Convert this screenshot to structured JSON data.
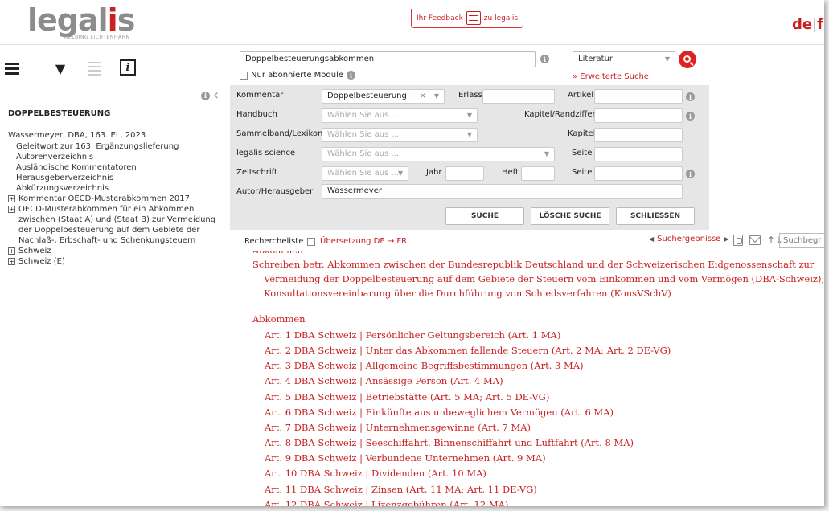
{
  "header": {
    "logo_text": "legalis",
    "logo_sub": "HELBING LICHTENHAHN",
    "feedback_left": "Ihr Feedback",
    "feedback_right": "zu legalis",
    "lang_active": "de",
    "lang_sep": "|",
    "lang_other": "f"
  },
  "toolbar": {
    "list_icon": "list-icon",
    "filter_icon": "filter-icon",
    "info_glyph": "i"
  },
  "sidebar": {
    "title": "DOPPELBESTEUERUNG",
    "root": "Wassermeyer, DBA, 163. EL, 2023",
    "leaves": [
      "Geleitwort zur 163. Ergänzungslieferung",
      "Autorenverzeichnis",
      "Ausländische Kommentatoren",
      "Herausgeberverzeichnis",
      "Abkürzungsverzeichnis"
    ],
    "nodes": [
      "Kommentar OECD-Musterabkommen 2017",
      "OECD-Musterabkommen für ein Abkommen zwischen (Staat A) und (Staat B) zur Vermeidung der Doppelbesteuerung auf dem Gebiete der Nachlaß-, Erbschaft- und Schenkungsteuern",
      "Schweiz",
      "Schweiz (E)"
    ],
    "expand_glyph": "+"
  },
  "search": {
    "query": "Doppelbesteuerungsabkommen",
    "only_subscribed": "Nur abonnierte Module",
    "scope": "Literatur",
    "advanced_link": "» Erweiterte Suche"
  },
  "advanced": {
    "kommentar_label": "Kommentar",
    "kommentar_value": "Doppelbesteuerung",
    "erlass_label": "Erlass",
    "artikel_label": "Artikel",
    "handbuch_label": "Handbuch",
    "placeholder": "Wählen Sie aus ...",
    "kapitel_rand_label": "Kapitel/Randziffer",
    "sammelband_label": "Sammelband/Lexikon",
    "kapitel_label": "Kapitel",
    "science_label": "legalis science",
    "seite_label": "Seite",
    "zeitschrift_label": "Zeitschrift",
    "jahr_label": "Jahr",
    "heft_label": "Heft",
    "autor_label": "Autor/Herausgeber",
    "autor_value": "Wassermeyer",
    "btn_suche": "SUCHE",
    "btn_loesche": "LÖSCHE SUCHE",
    "btn_schliessen": "SCHLIESSEN",
    "clear_glyph": "×",
    "arrow_glyph": "▼"
  },
  "results_toolbar": {
    "rechercheliste": "Rechercheliste",
    "uebersetzung": "Übersetzung DE → FR",
    "suchergebnisse": "Suchergebnisse",
    "prev_glyph": "◀",
    "next_glyph": "▶",
    "sort_glyph": "↑↓",
    "search_placeholder": "Suchbegr"
  },
  "content": {
    "title": "Schreiben betr. Abkommen zwischen der Bundesrepublik Deutschland und der Schweizerischen Eidgenossenschaft zur Vermeidung der Doppelbesteuerung auf dem Gebiete der Steuern vom Einkommen und vom Vermögen (DBA-Schweiz); Konsultationsvereinbarung über die Durchführung von Schiedsverfahren (KonsVSchV)",
    "section": "Abkommen",
    "articles": [
      "Art. 1 DBA Schweiz | Persönlicher Geltungsbereich (Art. 1 MA)",
      "Art. 2 DBA Schweiz | Unter das Abkommen fallende Steuern (Art. 2 MA; Art. 2 DE-VG)",
      "Art. 3 DBA Schweiz | Allgemeine Begriffsbestimmungen (Art. 3 MA)",
      "Art. 4 DBA Schweiz | Ansässige Person (Art. 4 MA)",
      "Art. 5 DBA Schweiz | Betriebstätte (Art. 5 MA; Art. 5 DE-VG)",
      "Art. 6 DBA Schweiz | Einkünfte aus unbeweglichem Vermögen (Art. 6 MA)",
      "Art. 7 DBA Schweiz | Unternehmensgewinne (Art. 7 MA)",
      "Art. 8 DBA Schweiz | Seeschiffahrt, Binnenschiffahrt und Luftfahrt (Art. 8 MA)",
      "Art. 9 DBA Schweiz | Verbundene Unternehmen (Art. 9 MA)",
      "Art. 10 DBA Schweiz | Dividenden (Art. 10 MA)",
      "Art. 11 DBA Schweiz | Zinsen (Art. 11 MA; Art. 11 DE-VG)",
      "Art. 12 DBA Schweiz | Lizenzgebühren (Art. 12 MA)"
    ]
  },
  "colors": {
    "brand_red": "#c92020",
    "logo_grey": "#8c8c8c",
    "panel_bg": "#e6e6e6"
  }
}
